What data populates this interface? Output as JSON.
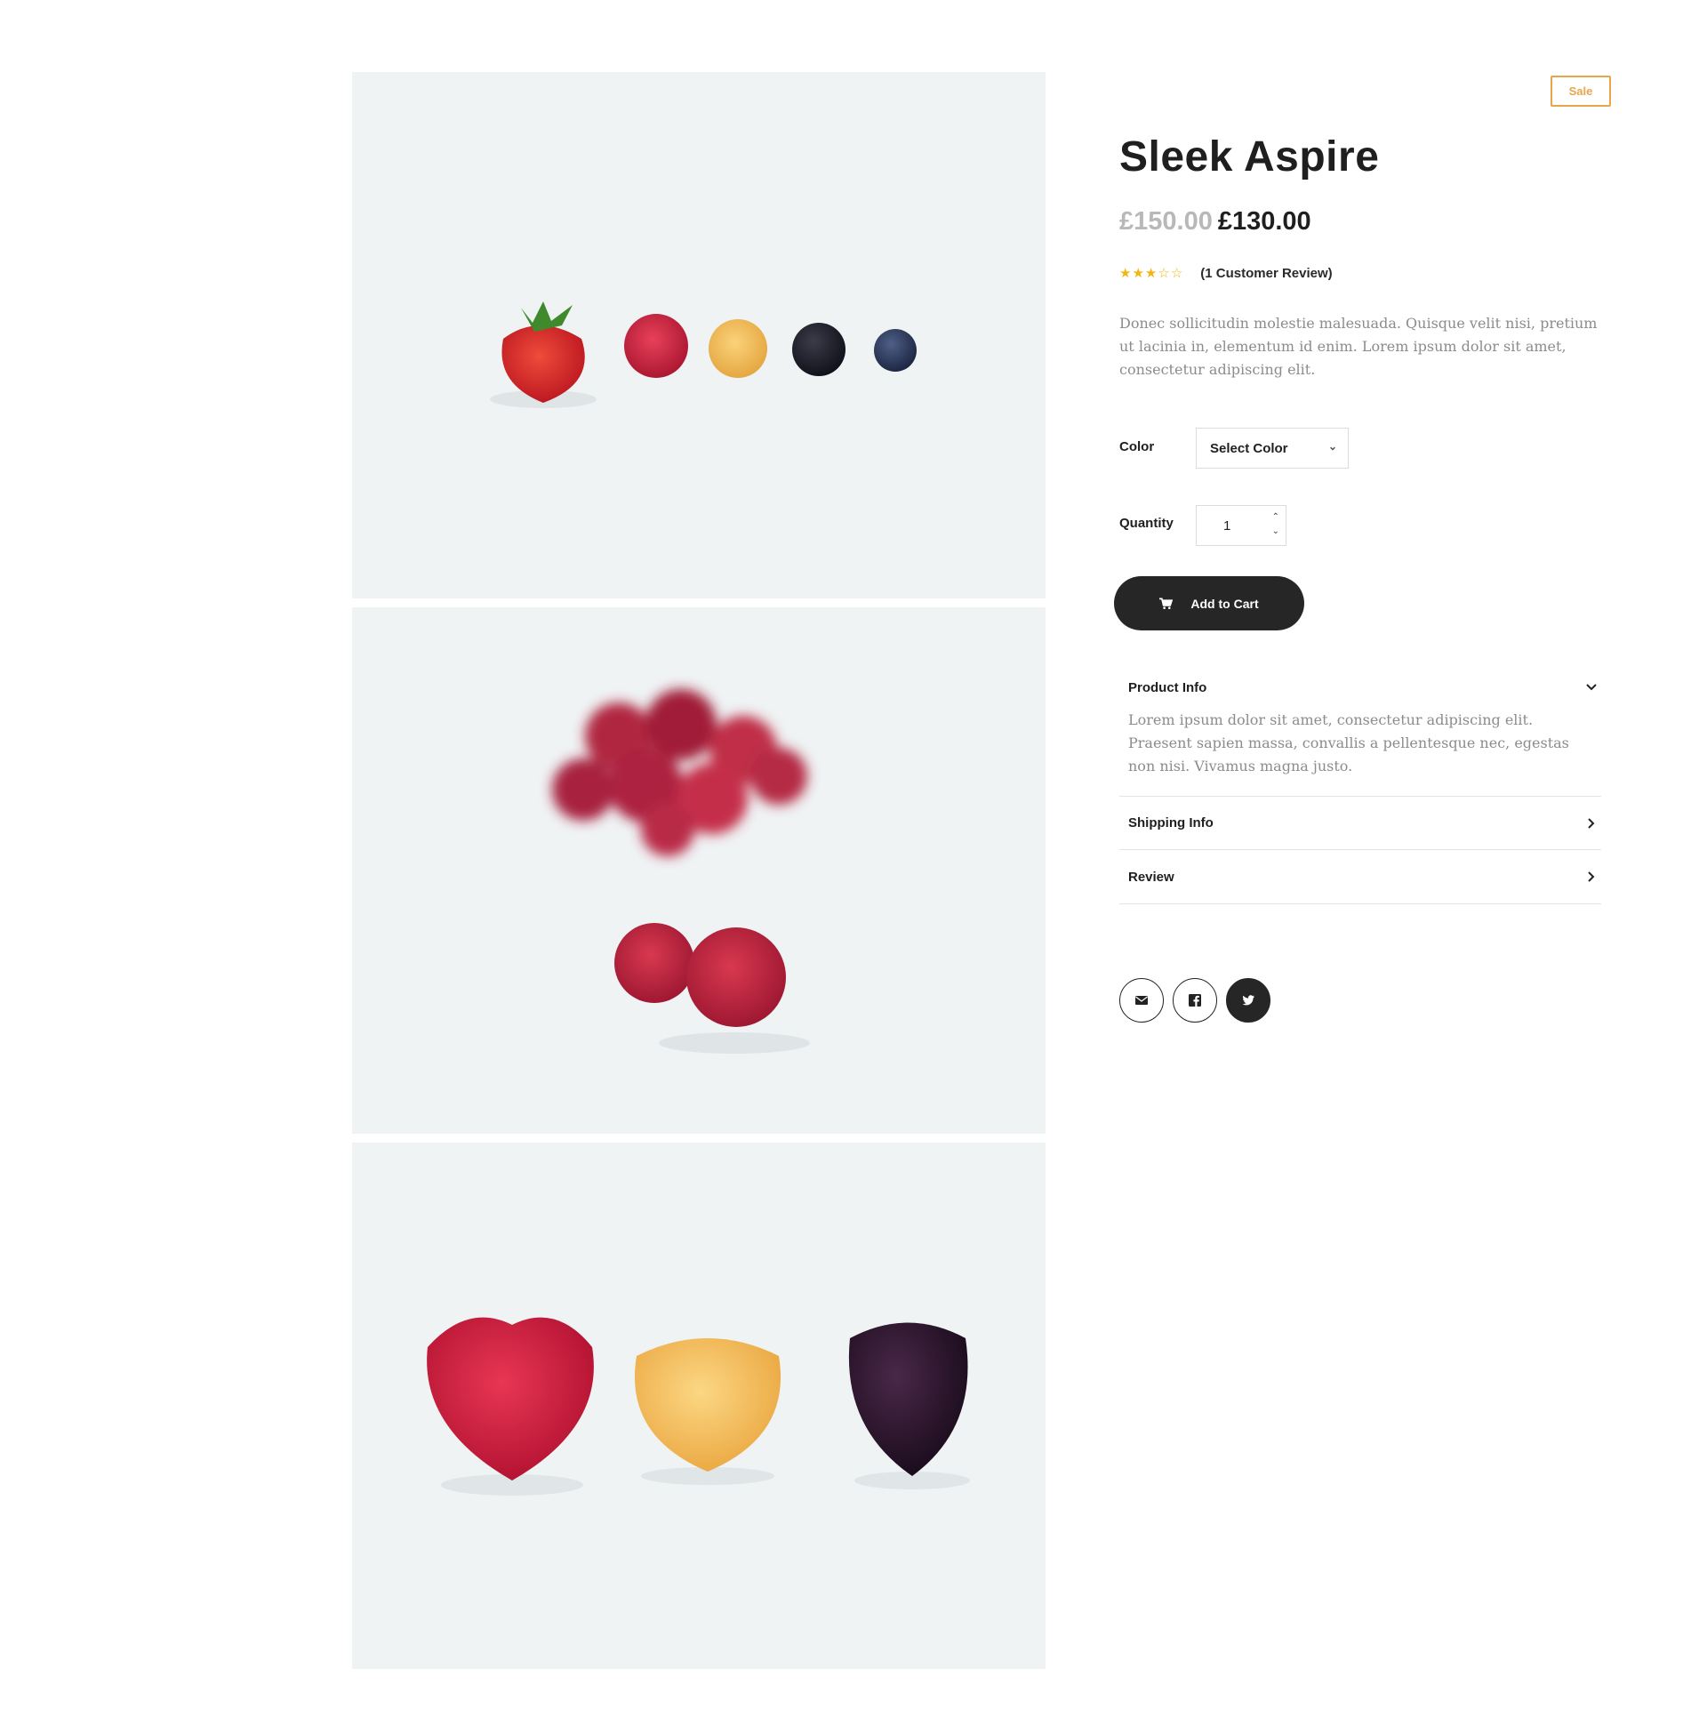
{
  "product": {
    "badge": "Sale",
    "title": "Sleek Aspire",
    "price_old": "£150.00",
    "price_new": "£130.00",
    "rating": 3,
    "rating_max": 5,
    "review_count_text": "(1 Customer Review)",
    "description": "Donec sollicitudin molestie malesuada. Quisque velit nisi, pretium ut lacinia in, elementum id enim. Lorem ipsum dolor sit amet, consectetur adipiscing elit."
  },
  "options": {
    "color_label": "Color",
    "color_value": "Select Color",
    "quantity_label": "Quantity",
    "quantity_value": "1"
  },
  "cart": {
    "add_label": "Add to Cart",
    "icon": "cart-icon"
  },
  "accordion": [
    {
      "label": "Product Info",
      "expanded": true,
      "body": "Lorem ipsum dolor sit amet, consectetur adipiscing elit. Praesent sapien massa, convallis a pellentesque nec, egestas non nisi. Vivamus magna justo."
    },
    {
      "label": "Shipping Info",
      "expanded": false
    },
    {
      "label": "Review",
      "expanded": false
    }
  ],
  "share": [
    {
      "icon": "envelope-icon"
    },
    {
      "icon": "facebook-icon"
    },
    {
      "icon": "twitter-icon"
    }
  ],
  "gallery": [
    {
      "icon": "berries-row-photo"
    },
    {
      "icon": "raspberries-photo"
    },
    {
      "icon": "three-berries-photo"
    }
  ],
  "colors": {
    "accent": "#e8a54b",
    "star": "#f3b510",
    "button": "#262626",
    "muted_text": "#8c8c8c",
    "photo_bg": "#eff3f4"
  }
}
